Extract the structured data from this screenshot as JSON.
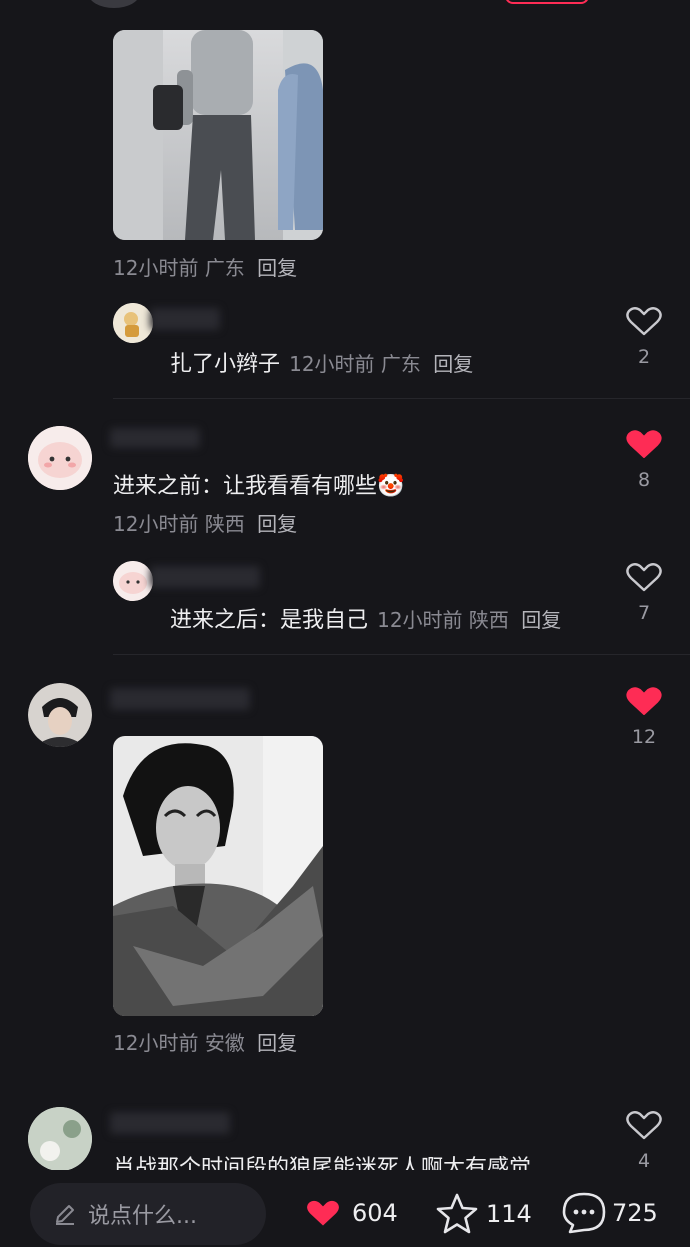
{
  "colors": {
    "accent": "#fe2c55",
    "background": "#16161a"
  },
  "comments": [
    {
      "meta": {
        "time": "12小时前",
        "location": "广东",
        "reply": "回复"
      },
      "replies": [
        {
          "text": "扎了小辫子",
          "time": "12小时前",
          "location": "广东",
          "reply": "回复",
          "likes": "2",
          "liked": false
        }
      ]
    },
    {
      "text": "进来之前：让我看看有哪些🤡",
      "time": "12小时前",
      "location": "陕西",
      "reply": "回复",
      "likes": "8",
      "liked": true,
      "replies": [
        {
          "text": "进来之后：是我自己",
          "time": "12小时前",
          "location": "陕西",
          "reply": "回复",
          "likes": "7",
          "liked": false
        }
      ]
    },
    {
      "time": "12小时前",
      "location": "安徽",
      "reply": "回复",
      "likes": "12",
      "liked": true
    },
    {
      "text": "肖战那个时间段的狼尾能迷死人啊太有感觉",
      "likes": "4",
      "liked": false
    }
  ],
  "bottom_bar": {
    "input_placeholder": "说点什么...",
    "like_count": "604",
    "favorite_count": "114",
    "comment_count": "725"
  }
}
